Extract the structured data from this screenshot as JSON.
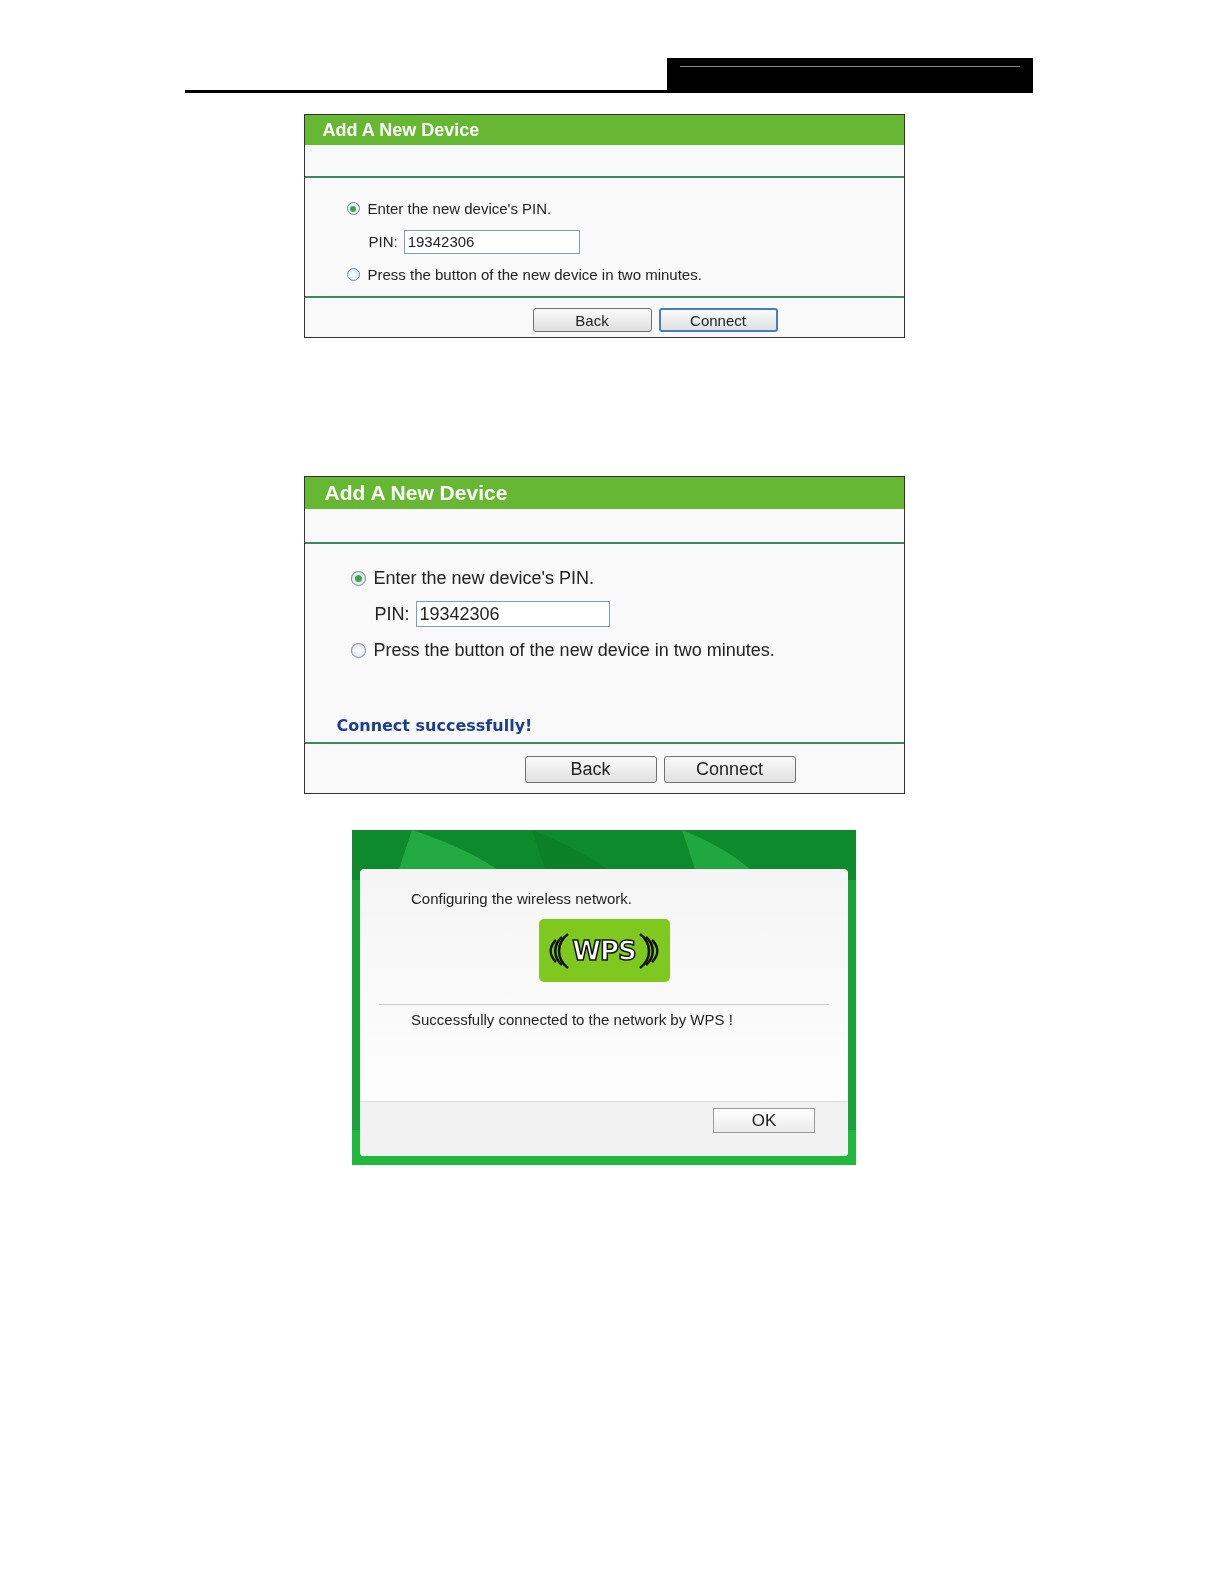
{
  "panels": [
    {
      "title": "Add A New Device",
      "options": [
        {
          "label": "Enter the new device's PIN.",
          "selected": true
        },
        {
          "label": "Press the button of the new device in two minutes.",
          "selected": false
        }
      ],
      "pin_label": "PIN:",
      "pin_value": "19342306",
      "buttons": [
        {
          "label": "Back",
          "focused": false
        },
        {
          "label": "Connect",
          "focused": true
        }
      ]
    },
    {
      "title": "Add A New Device",
      "options": [
        {
          "label": "Enter the new device's PIN.",
          "selected": true
        },
        {
          "label": "Press the button of the new device in two minutes.",
          "selected": false
        }
      ],
      "pin_label": "PIN:",
      "pin_value": "19342306",
      "status": "Connect successfully!",
      "buttons": [
        {
          "label": "Back",
          "focused": false
        },
        {
          "label": "Connect",
          "focused": false
        }
      ]
    }
  ],
  "dialog": {
    "message": "Configuring the wireless network.",
    "logo_text": "WPS",
    "result": "Successfully connected to the network by WPS !",
    "ok_button": "OK"
  }
}
